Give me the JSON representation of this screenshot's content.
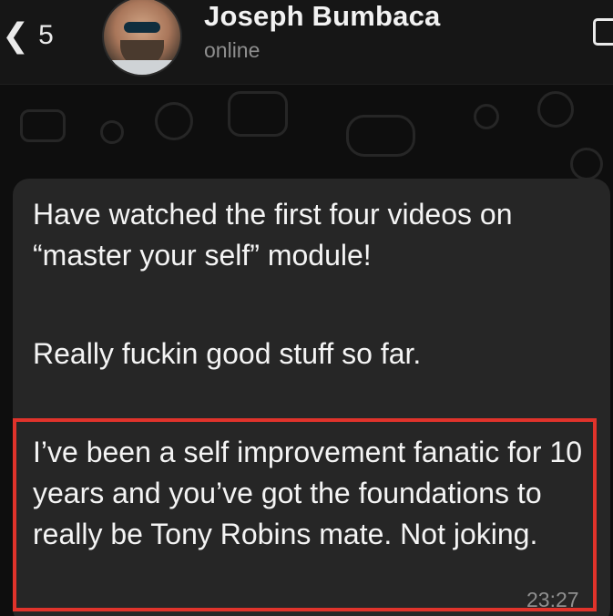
{
  "header": {
    "back_count": "5",
    "contact_name": "Joseph Bumbaca",
    "status": "online"
  },
  "message": {
    "paragraph_1": "Have watched the first four videos on “master your self” module!",
    "paragraph_2": "Really fuckin good stuff so far.",
    "paragraph_3": "I’ve been a self improvement fanatic for 10 years and you’ve got the foundations to really be Tony Robins mate. Not joking.",
    "time": "23:27"
  },
  "colors": {
    "highlight_border": "#e0332b",
    "bubble_bg": "#262626",
    "header_bg": "#161616"
  },
  "icons": [
    "chevron-left-icon",
    "avatar",
    "window-icon"
  ]
}
